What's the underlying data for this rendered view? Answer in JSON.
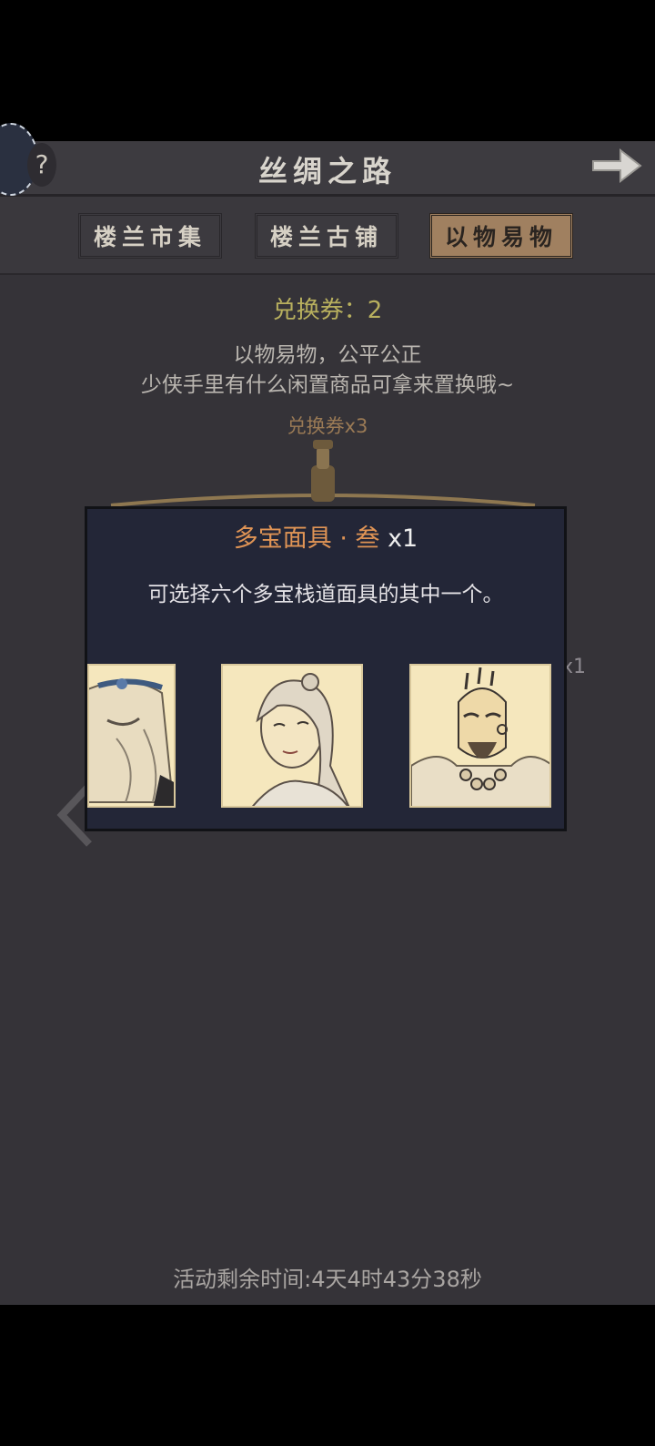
{
  "header": {
    "title": "丝绸之路",
    "help_label": "?"
  },
  "tabs": [
    {
      "label": "楼兰市集",
      "active": false
    },
    {
      "label": "楼兰古铺",
      "active": false
    },
    {
      "label": "以物易物",
      "active": true
    }
  ],
  "exchange": {
    "coupon_count": "兑换券：2",
    "desc_line1": "以物易物，公平公正",
    "desc_line2": "少侠手里有什么闲置商品可拿来置换哦~",
    "cost": "兑换券x3",
    "stray_qty": "x1"
  },
  "modal": {
    "item_name": "多宝面具 · 叁",
    "item_qty": " x1",
    "description": "可选择六个多宝栈道面具的其中一个。",
    "masks": [
      "elder-mask",
      "lady-mask",
      "warrior-monk-mask"
    ]
  },
  "footer": {
    "remaining": "活动剩余时间:4天4时43分38秒"
  },
  "colors": {
    "background": "#353338",
    "active_tab": "#a08060",
    "accent_orange": "#e09455",
    "coupon": "#b8b05e"
  }
}
